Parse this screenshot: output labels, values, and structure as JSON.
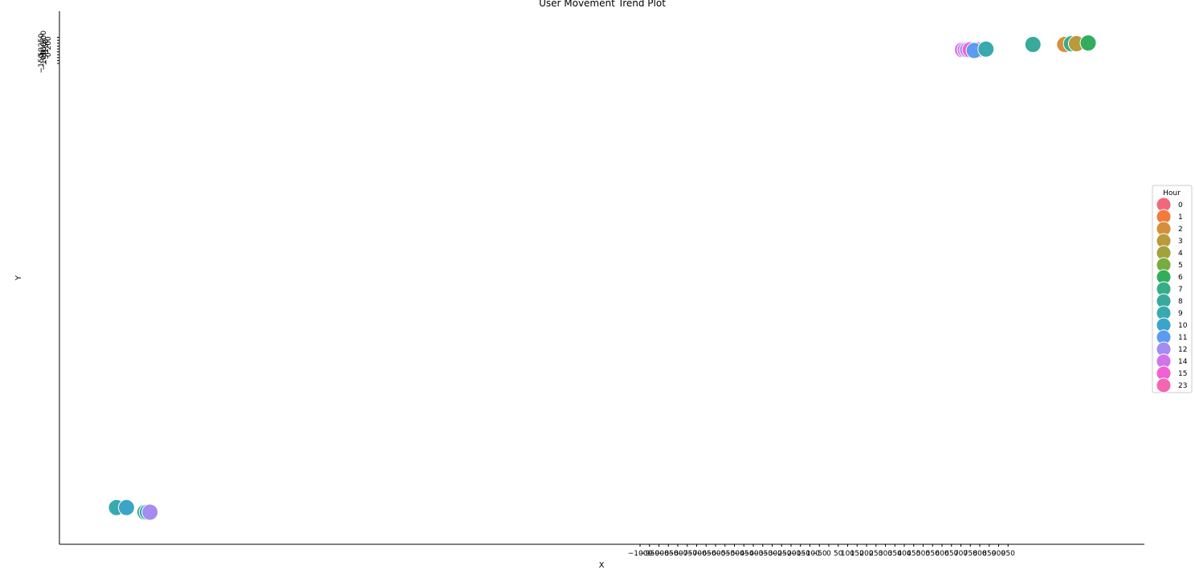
{
  "chart_data": {
    "type": "scatter",
    "title": "User Movement Trend Plot",
    "xlabel": "X",
    "ylabel": "Y",
    "legend_title": "Hour",
    "legend_position": "right",
    "grid": false,
    "x_ticks": [
      "−1000",
      "−950",
      "−900",
      "−850",
      "−800",
      "−750",
      "−700",
      "−650",
      "−600",
      "−550",
      "−500",
      "−450",
      "−400",
      "−350",
      "−300",
      "−250",
      "−200",
      "−150",
      "−100",
      "−50",
      "0",
      "50",
      "100",
      "150",
      "200",
      "250",
      "300",
      "350",
      "400",
      "450",
      "500",
      "550",
      "600",
      "650",
      "700",
      "750",
      "800",
      "850",
      "900",
      "950"
    ],
    "y_ticks": [
      "−150",
      "−100",
      "−50",
      "0",
      "50",
      "100",
      "150",
      "200",
      "250",
      "300"
    ],
    "legend": [
      {
        "label": "0",
        "color": "#f0687a"
      },
      {
        "label": "1",
        "color": "#f27a3a"
      },
      {
        "label": "2",
        "color": "#d48f3c"
      },
      {
        "label": "3",
        "color": "#b99a3c"
      },
      {
        "label": "4",
        "color": "#a2a23a"
      },
      {
        "label": "5",
        "color": "#77ad3e"
      },
      {
        "label": "6",
        "color": "#32ad5e"
      },
      {
        "label": "7",
        "color": "#35ad86"
      },
      {
        "label": "8",
        "color": "#37aa9c"
      },
      {
        "label": "9",
        "color": "#39a9b0"
      },
      {
        "label": "10",
        "color": "#3aa5c8"
      },
      {
        "label": "11",
        "color": "#5b9cf0"
      },
      {
        "label": "12",
        "color": "#a48cf0"
      },
      {
        "label": "14",
        "color": "#d273e8"
      },
      {
        "label": "15",
        "color": "#f061d3"
      },
      {
        "label": "23",
        "color": "#f466b2"
      }
    ],
    "points": [
      {
        "hour": "0",
        "x": 1500,
        "y": 300
      },
      {
        "hour": "14",
        "x": 1455,
        "y": 300
      },
      {
        "hour": "14",
        "x": 1463,
        "y": 300
      },
      {
        "hour": "12",
        "x": 1470,
        "y": 300
      },
      {
        "hour": "15",
        "x": 1478,
        "y": 300
      },
      {
        "hour": "11",
        "x": 1490,
        "y": 295
      },
      {
        "hour": "9",
        "x": 1525,
        "y": 305
      },
      {
        "hour": "8",
        "x": 1665,
        "y": 335
      },
      {
        "hour": "2",
        "x": 1760,
        "y": 335
      },
      {
        "hour": "7",
        "x": 1780,
        "y": 340
      },
      {
        "hour": "3",
        "x": 1795,
        "y": 340
      },
      {
        "hour": "6",
        "x": 1830,
        "y": 345
      },
      {
        "hour": "9",
        "x": -1070,
        "y": -2720
      },
      {
        "hour": "10",
        "x": -1040,
        "y": -2720
      },
      {
        "hour": "7",
        "x": -985,
        "y": -2750
      },
      {
        "hour": "9",
        "x": -978,
        "y": -2750
      },
      {
        "hour": "12",
        "x": -970,
        "y": -2750
      }
    ]
  }
}
